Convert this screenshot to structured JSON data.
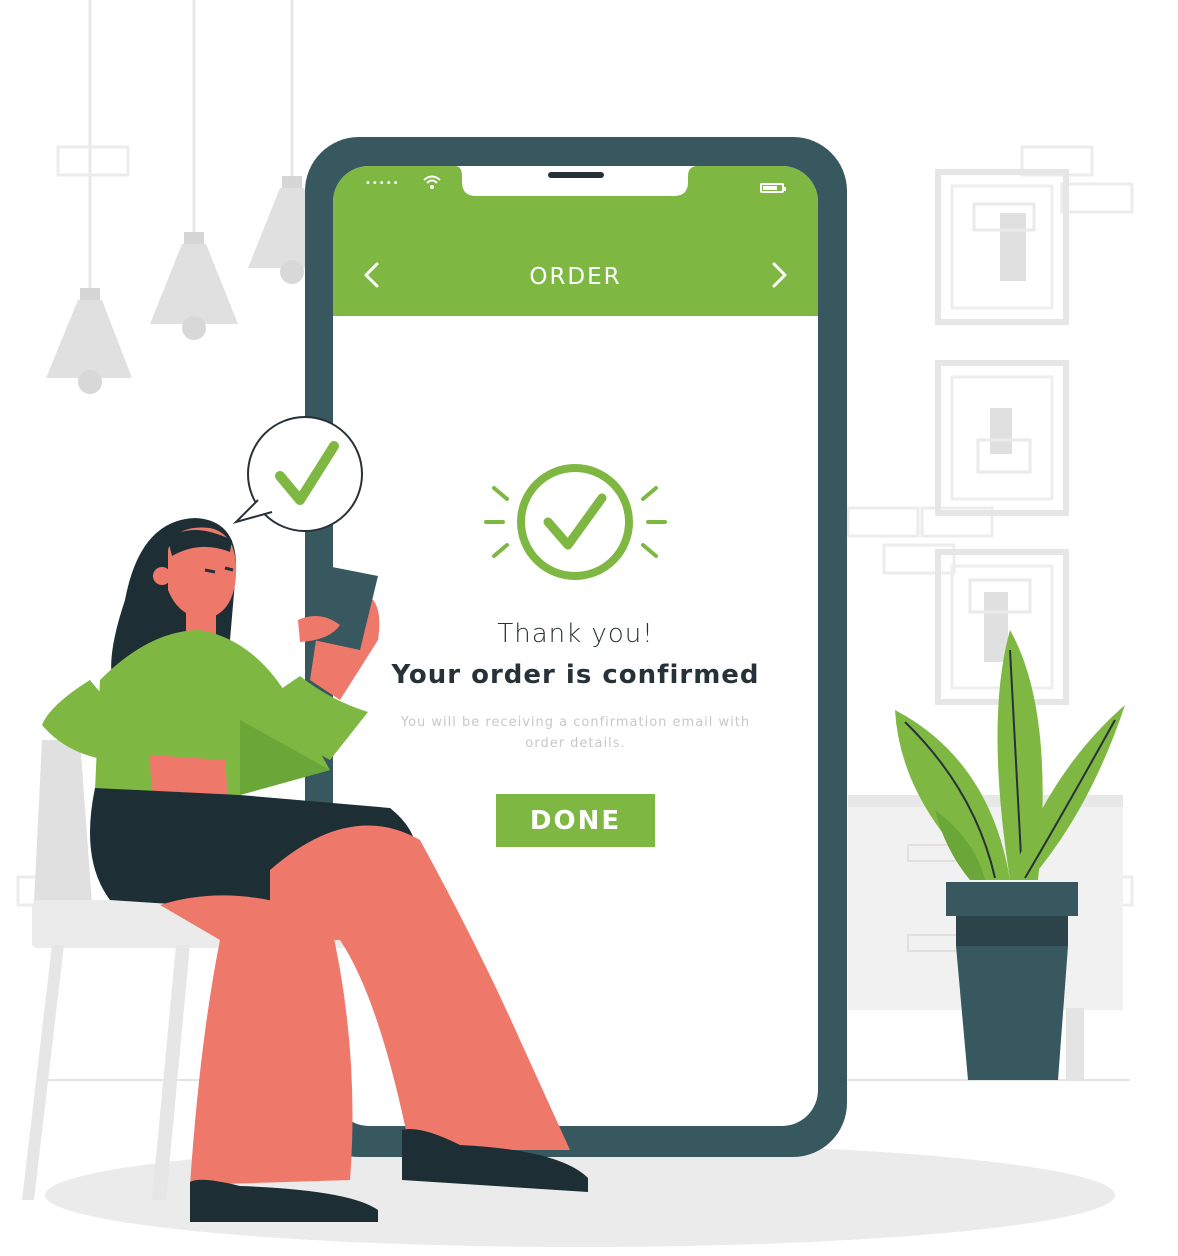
{
  "colors": {
    "accent": "#7eb843",
    "phone_frame": "#37585f",
    "text_dark": "#263238",
    "skin": "#ee786a",
    "hair": "#1d2f35"
  },
  "icons": {
    "back": "chevron-left-icon",
    "forward": "chevron-right-icon",
    "signal": "signal-dots-icon",
    "wifi": "wifi-icon",
    "battery": "battery-icon",
    "success": "check-circle-icon",
    "bubble": "speech-bubble-check-icon"
  },
  "status_bar": {
    "signal": "•••••",
    "battery_level": 0.7
  },
  "nav": {
    "title": "ORDER"
  },
  "confirmation": {
    "heading": "Thank you!",
    "title": "Your order is confirmed",
    "message": "You will be receiving a confirmation email with order details."
  },
  "actions": {
    "done_label": "DONE"
  }
}
